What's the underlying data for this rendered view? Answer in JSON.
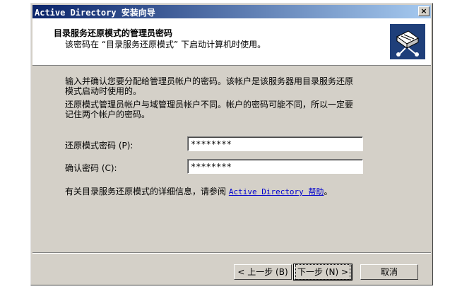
{
  "window": {
    "title": "Active Directory 安装向导",
    "close": "×"
  },
  "header": {
    "title": "目录服务还原模式的管理员密码",
    "subtitle": "该密码在 “目录服务还原模式” 下启动计算机时使用。"
  },
  "body": {
    "para1_line1": "输入并确认您要分配给管理员帐户的密码。该帐户是该服务器用目录服务还原",
    "para1_line2": "模式启动时使用的。",
    "para2_line1": "还原模式管理员帐户与域管理员帐户不同。帐户的密码可能不同，所以一定要",
    "para2_line2": "记住两个帐户的密码。"
  },
  "form": {
    "password_label": "还原模式密码 (P):",
    "password_value": "********",
    "confirm_label": "确认密码 (C):",
    "confirm_value": "********"
  },
  "help": {
    "text": "有关目录服务还原模式的详细信息，请参阅",
    "link": "Active Directory 帮助",
    "suffix": "。"
  },
  "buttons": {
    "back": "< 上一步 (B)",
    "next": "下一步 (N) >",
    "cancel": "取消"
  }
}
